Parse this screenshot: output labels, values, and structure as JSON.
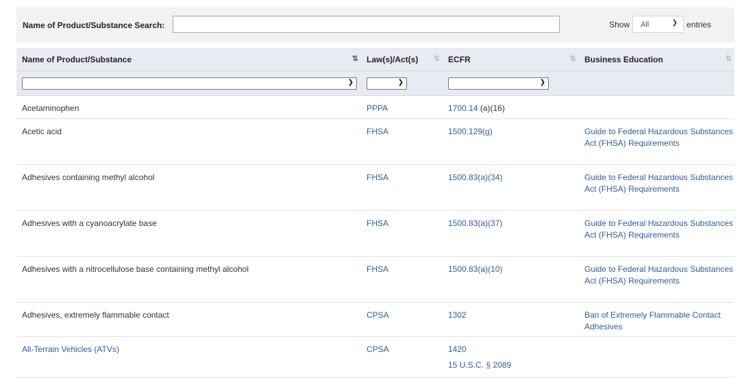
{
  "search": {
    "label": "Name of Product/Substance Search:",
    "value": "",
    "show_label": "Show",
    "show_value": "All",
    "entries_label": "entries"
  },
  "table": {
    "headers": [
      {
        "label": "Name of Product/Substance",
        "sort": "asc"
      },
      {
        "label": "Law(s)/Act(s)",
        "sort": "none"
      },
      {
        "label": "ECFR",
        "sort": "none"
      },
      {
        "label": "Business Education",
        "sort": "none"
      }
    ],
    "rows": [
      {
        "name": "Acetaminophen",
        "law": "PPPA",
        "ecfr": [
          "1700.14 (a)(16)"
        ],
        "ecfr_link_part": "1700.14",
        "ecfr_rest": " (a)(16)",
        "edu": ""
      },
      {
        "name": "Acetic acid",
        "law": "FHSA",
        "ecfr": [
          "1500.129(g)"
        ],
        "edu": "Guide to Federal Hazardous Substances Act (FHSA) Requirements"
      },
      {
        "name": "Adhesives containing methyl alcohol",
        "law": "FHSA",
        "ecfr": [
          "1500.83(a)(34)"
        ],
        "edu": "Guide to Federal Hazardous Substances Act (FHSA) Requirements"
      },
      {
        "name": "Adhesives with a cyanoacrylate base",
        "law": "FHSA",
        "ecfr": [
          "1500.83(a)(37)"
        ],
        "edu": "Guide to Federal Hazardous Substances Act (FHSA) Requirements"
      },
      {
        "name": "Adhesives with a nitrocellulose base containing methyl alcohol",
        "law": "FHSA",
        "ecfr": [
          "1500.83(a)(10)"
        ],
        "edu": "Guide to Federal Hazardous Substances Act (FHSA) Requirements"
      },
      {
        "name": "Adhesives, extremely flammable contact",
        "law": "CPSA",
        "ecfr": [
          "1302"
        ],
        "edu": "Ban of Extremely Flammable Contact Adhesives"
      },
      {
        "name": "All-Terrain Vehicles (ATVs)",
        "law": "CPSA",
        "ecfr": [
          "1420",
          "15 U.S.C. § 2089"
        ],
        "edu": ""
      }
    ]
  },
  "colors": {
    "link": "#2f5aa5",
    "header_bg": "#e9ebf3",
    "search_bg": "#f2f2f2"
  }
}
